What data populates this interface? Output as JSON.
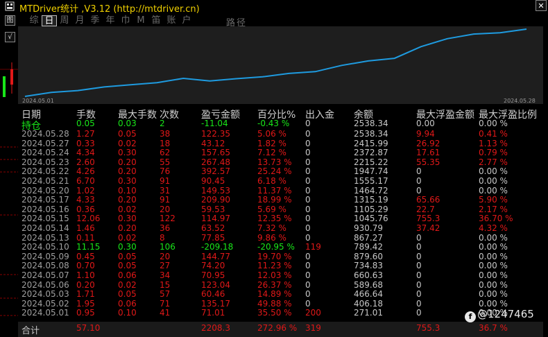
{
  "window": {
    "title": "MTDriver统计 ,V3.12 (http://mtdriver.cn)",
    "close": "✕"
  },
  "side_buttons": [
    "图",
    "√"
  ],
  "tabs": [
    {
      "label": "综"
    },
    {
      "label": "日",
      "active": true
    },
    {
      "label": "周"
    },
    {
      "label": "月"
    },
    {
      "label": "季"
    },
    {
      "label": "年"
    },
    {
      "label": "巾"
    },
    {
      "label": "M"
    },
    {
      "label": "笛"
    },
    {
      "label": "账"
    },
    {
      "label": "户"
    }
  ],
  "tab_extra": "路径",
  "equity_chart": {
    "start_date": "2024.05.01",
    "end_date": "2024.05.28",
    "line_color": "#1e9be0",
    "x": [
      "2024.05.01",
      "2024.05.02",
      "2024.05.03",
      "2024.05.06",
      "2024.05.07",
      "2024.05.08",
      "2024.05.09",
      "2024.05.10",
      "2024.05.13",
      "2024.05.14",
      "2024.05.15",
      "2024.05.16",
      "2024.05.17",
      "2024.05.20",
      "2024.05.21",
      "2024.05.22",
      "2024.05.23",
      "2024.05.24",
      "2024.05.27",
      "2024.05.28"
    ],
    "y": [
      271.01,
      406.18,
      466.64,
      589.68,
      660.63,
      734.83,
      879.6,
      789.42,
      867.27,
      930.79,
      1045.76,
      1105.29,
      1315.19,
      1464.72,
      1555.17,
      1947.74,
      2215.22,
      2372.87,
      2415.99,
      2538.34
    ]
  },
  "headers": [
    "日期",
    "手数",
    "最大手数",
    "次数",
    "盈亏金额",
    "百分比%",
    "出入金",
    "余额",
    "最大浮盈金额",
    "最大浮盈比例"
  ],
  "colors": {
    "green": "#19e619",
    "red": "#e01818",
    "gray": "#c8c8c8",
    "yellow": "#f0d000"
  },
  "holding_row": {
    "date": "持仓",
    "lots": "0.05",
    "max_lots": "0.03",
    "count": "2",
    "pnl": "-11.04",
    "pct": "-0.43 %",
    "flow": "0",
    "balance": "2538.34",
    "max_float": "0.00",
    "max_float_pct": "0.00 %",
    "color": "green"
  },
  "rows": [
    {
      "date": "2024.05.28",
      "lots": "1.27",
      "max_lots": "0.05",
      "count": "38",
      "pnl": "122.35",
      "pct": "5.06 %",
      "flow": "0",
      "balance": "2538.34",
      "max_float": "9.94",
      "max_float_pct": "0.41 %",
      "color": "red",
      "float_color": "red"
    },
    {
      "date": "2024.05.27",
      "lots": "0.33",
      "max_lots": "0.02",
      "count": "18",
      "pnl": "43.12",
      "pct": "1.82 %",
      "flow": "0",
      "balance": "2415.99",
      "max_float": "26.92",
      "max_float_pct": "1.13 %",
      "color": "red",
      "float_color": "red"
    },
    {
      "date": "2024.05.24",
      "lots": "4.34",
      "max_lots": "0.30",
      "count": "62",
      "pnl": "157.65",
      "pct": "7.12 %",
      "flow": "0",
      "balance": "2372.87",
      "max_float": "17.61",
      "max_float_pct": "0.79 %",
      "color": "red",
      "float_color": "red"
    },
    {
      "date": "2024.05.23",
      "lots": "2.60",
      "max_lots": "0.20",
      "count": "55",
      "pnl": "267.48",
      "pct": "13.73 %",
      "flow": "0",
      "balance": "2215.22",
      "max_float": "55.35",
      "max_float_pct": "2.77 %",
      "color": "red",
      "float_color": "red"
    },
    {
      "date": "2024.05.22",
      "lots": "4.26",
      "max_lots": "0.20",
      "count": "76",
      "pnl": "392.57",
      "pct": "25.24 %",
      "flow": "0",
      "balance": "1947.74",
      "max_float": "0",
      "max_float_pct": "0.00 %",
      "color": "red",
      "float_color": "gray"
    },
    {
      "date": "2024.05.21",
      "lots": "6.70",
      "max_lots": "0.30",
      "count": "91",
      "pnl": "90.45",
      "pct": "6.18 %",
      "flow": "0",
      "balance": "1555.17",
      "max_float": "0",
      "max_float_pct": "0.00 %",
      "color": "red",
      "float_color": "gray"
    },
    {
      "date": "2024.05.20",
      "lots": "1.02",
      "max_lots": "0.10",
      "count": "31",
      "pnl": "149.53",
      "pct": "11.37 %",
      "flow": "0",
      "balance": "1464.72",
      "max_float": "0",
      "max_float_pct": "0.00 %",
      "color": "red",
      "float_color": "gray"
    },
    {
      "date": "2024.05.17",
      "lots": "4.33",
      "max_lots": "0.20",
      "count": "91",
      "pnl": "209.90",
      "pct": "18.99 %",
      "flow": "0",
      "balance": "1315.19",
      "max_float": "65.66",
      "max_float_pct": "5.90 %",
      "color": "red",
      "float_color": "red"
    },
    {
      "date": "2024.05.16",
      "lots": "0.36",
      "max_lots": "0.02",
      "count": "20",
      "pnl": "59.53",
      "pct": "5.69 %",
      "flow": "0",
      "balance": "1105.29",
      "max_float": "22.7",
      "max_float_pct": "2.17 %",
      "color": "red",
      "float_color": "red"
    },
    {
      "date": "2024.05.15",
      "lots": "12.06",
      "max_lots": "0.30",
      "count": "122",
      "pnl": "114.97",
      "pct": "12.35 %",
      "flow": "0",
      "balance": "1045.76",
      "max_float": "755.3",
      "max_float_pct": "36.70 %",
      "color": "red",
      "float_color": "red"
    },
    {
      "date": "2024.05.14",
      "lots": "1.46",
      "max_lots": "0.20",
      "count": "36",
      "pnl": "63.52",
      "pct": "7.32 %",
      "flow": "0",
      "balance": "930.79",
      "max_float": "37.42",
      "max_float_pct": "4.32 %",
      "color": "red",
      "float_color": "red"
    },
    {
      "date": "2024.05.13",
      "lots": "0.11",
      "max_lots": "0.02",
      "count": "8",
      "pnl": "77.85",
      "pct": "9.86 %",
      "flow": "0",
      "balance": "867.27",
      "max_float": "0",
      "max_float_pct": "0.00 %",
      "color": "red",
      "float_color": "gray"
    },
    {
      "date": "2024.05.10",
      "lots": "11.15",
      "max_lots": "0.30",
      "count": "106",
      "pnl": "-209.18",
      "pct": "-20.95 %",
      "flow": "119",
      "balance": "789.42",
      "max_float": "0",
      "max_float_pct": "0.00 %",
      "color": "green",
      "float_color": "gray",
      "flow_color": "red"
    },
    {
      "date": "2024.05.09",
      "lots": "0.45",
      "max_lots": "0.05",
      "count": "20",
      "pnl": "144.77",
      "pct": "19.70 %",
      "flow": "0",
      "balance": "879.60",
      "max_float": "0",
      "max_float_pct": "0.00 %",
      "color": "red",
      "float_color": "gray"
    },
    {
      "date": "2024.05.08",
      "lots": "0.70",
      "max_lots": "0.05",
      "count": "27",
      "pnl": "74.20",
      "pct": "11.23 %",
      "flow": "0",
      "balance": "734.83",
      "max_float": "0",
      "max_float_pct": "0.00 %",
      "color": "red",
      "float_color": "gray"
    },
    {
      "date": "2024.05.07",
      "lots": "1.10",
      "max_lots": "0.06",
      "count": "34",
      "pnl": "70.95",
      "pct": "12.03 %",
      "flow": "0",
      "balance": "660.63",
      "max_float": "0",
      "max_float_pct": "0.00 %",
      "color": "red",
      "float_color": "gray"
    },
    {
      "date": "2024.05.06",
      "lots": "0.20",
      "max_lots": "0.02",
      "count": "15",
      "pnl": "123.04",
      "pct": "26.37 %",
      "flow": "0",
      "balance": "589.68",
      "max_float": "0",
      "max_float_pct": "0.00 %",
      "color": "red",
      "float_color": "gray"
    },
    {
      "date": "2024.05.03",
      "lots": "1.71",
      "max_lots": "0.05",
      "count": "57",
      "pnl": "60.46",
      "pct": "14.89 %",
      "flow": "0",
      "balance": "466.64",
      "max_float": "0",
      "max_float_pct": "0.00 %",
      "color": "red",
      "float_color": "gray"
    },
    {
      "date": "2024.05.02",
      "lots": "1.95",
      "max_lots": "0.06",
      "count": "71",
      "pnl": "135.17",
      "pct": "49.88 %",
      "flow": "0",
      "balance": "406.18",
      "max_float": "0",
      "max_float_pct": "0.00 %",
      "color": "red",
      "float_color": "gray"
    },
    {
      "date": "2024.05.01",
      "lots": "0.95",
      "max_lots": "0.10",
      "count": "41",
      "pnl": "71.01",
      "pct": "35.50 %",
      "flow": "200",
      "balance": "271.01",
      "max_float": "0",
      "max_float_pct": "0.00 %",
      "color": "red",
      "float_color": "gray",
      "flow_color": "red"
    }
  ],
  "total_row": {
    "date": "合计",
    "lots": "57.10",
    "max_lots": "",
    "count": "",
    "pnl": "2208.3",
    "pct": "272.96 %",
    "flow": "319",
    "balance": "",
    "max_float": "755.3",
    "max_float_pct": "36.7 %"
  },
  "watermark": {
    "icon": "f",
    "text": "@1247465"
  }
}
